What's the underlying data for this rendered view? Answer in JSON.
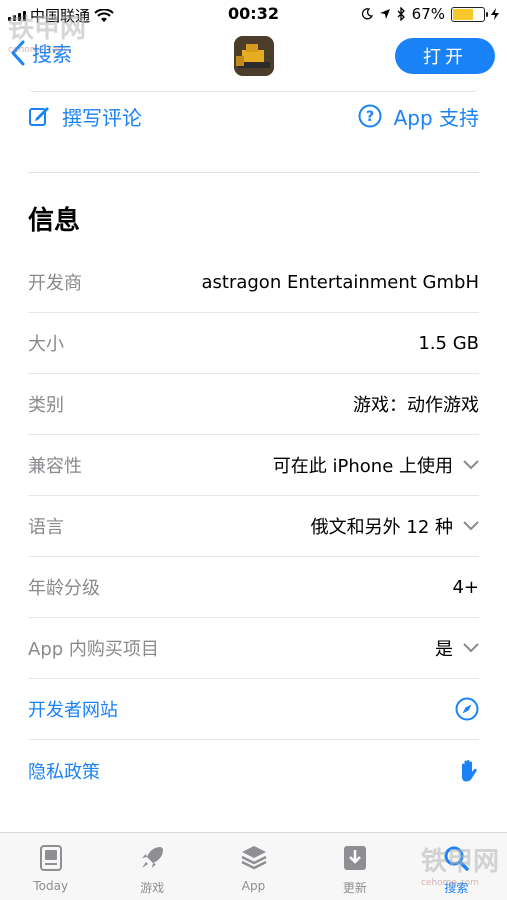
{
  "status_bar": {
    "carrier": "中国联通",
    "time": "00:32",
    "battery_percent": "67%",
    "battery_level": 0.67
  },
  "nav": {
    "back_label": "搜索",
    "open_label": "打开"
  },
  "actions": {
    "write_review": "撰写评论",
    "app_support": "App 支持"
  },
  "section_title": "信息",
  "info_rows": [
    {
      "label": "开发商",
      "value": "astragon Entertainment GmbH"
    },
    {
      "label": "大小",
      "value": "1.5 GB"
    },
    {
      "label": "类别",
      "value": "游戏：动作游戏"
    },
    {
      "label": "兼容性",
      "value": "可在此 iPhone 上使用"
    },
    {
      "label": "语言",
      "value": "俄文和另外 12 种"
    },
    {
      "label": "年龄分级",
      "value": "4+"
    },
    {
      "label": "App 内购买项目",
      "value": "是"
    },
    {
      "label": "开发者网站",
      "value": ""
    },
    {
      "label": "隐私政策",
      "value": ""
    }
  ],
  "tabs": [
    {
      "label": "Today"
    },
    {
      "label": "游戏"
    },
    {
      "label": "App"
    },
    {
      "label": "更新"
    },
    {
      "label": "搜索"
    }
  ],
  "watermark": {
    "text": "铁甲网",
    "sub": "cehome.com"
  },
  "colors": {
    "accent": "#1a82f7",
    "label_gray": "#8a8a8e",
    "battery": "#f6c82b"
  }
}
